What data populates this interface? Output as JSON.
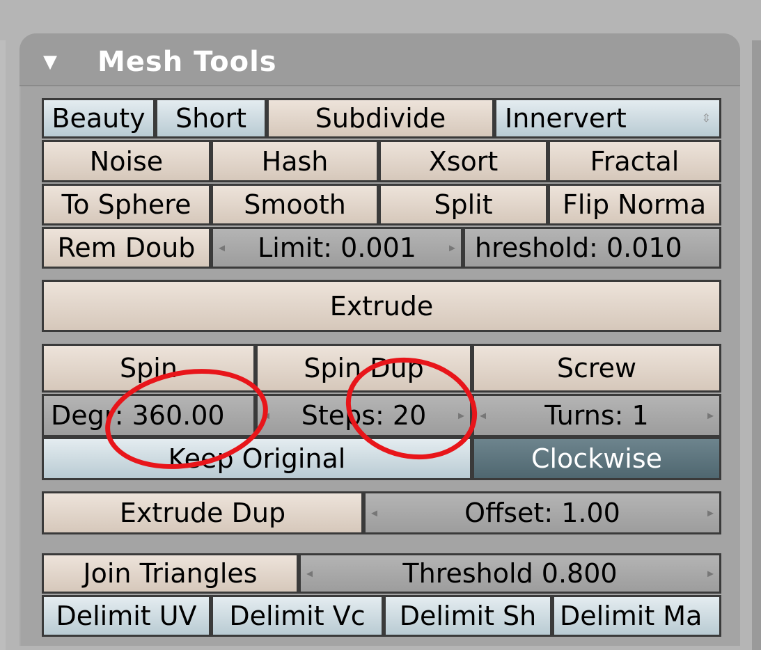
{
  "panel": {
    "title": "Mesh Tools",
    "collapse_icon": "triangle-down-icon"
  },
  "row1": {
    "beauty": "Beauty",
    "short": "Short",
    "subdivide": "Subdivide",
    "innervert": "Innervert"
  },
  "row2": {
    "noise": "Noise",
    "hash": "Hash",
    "xsort": "Xsort",
    "fractal": "Fractal"
  },
  "row3": {
    "to_sphere": "To Sphere",
    "smooth": "Smooth",
    "split": "Split",
    "flip_normals": "Flip Norma"
  },
  "row4": {
    "rem_doub": "Rem Doub",
    "limit": "Limit: 0.001",
    "threshold": "hreshold: 0.010"
  },
  "extrude": "Extrude",
  "spin_group": {
    "spin": "Spin",
    "spin_dup": "Spin Dup",
    "screw": "Screw",
    "degr": "Degr: 360.00",
    "steps": "Steps: 20",
    "turns": "Turns: 1",
    "keep_original": "Keep Original",
    "clockwise": "Clockwise"
  },
  "extrude_dup": {
    "label": "Extrude Dup",
    "offset": "Offset: 1.00"
  },
  "join": {
    "label": "Join Triangles",
    "threshold": "Threshold 0.800",
    "delimit_uv": "Delimit UV",
    "delimit_vc": "Delimit Vc",
    "delimit_sh": "Delimit Sh",
    "delimit_ma": "Delimit Ma"
  },
  "colors": {
    "annotation": "#e8151a",
    "active_toggle": "#5b717a"
  }
}
